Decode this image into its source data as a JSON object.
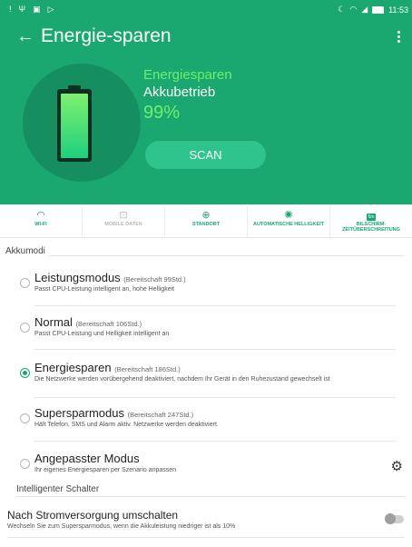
{
  "status_bar": {
    "left_icons": [
      "warning-icon",
      "usb-icon",
      "gallery-icon",
      "play-icon"
    ],
    "right_icons": [
      "moon-icon",
      "wifi-icon",
      "signal-icon",
      "battery-icon"
    ],
    "time": "11:53"
  },
  "app_bar": {
    "back_icon": "arrow-left-icon",
    "title": "Energie-sparen",
    "menu_icon": "kebab-icon"
  },
  "battery_panel": {
    "mode_green": "Energiesparen",
    "mode_white": "Akkubetrieb",
    "percent_text": "99%",
    "percent_value": 99,
    "scan_label": "SCAN"
  },
  "quick_toggles": [
    {
      "icon": "wifi-icon",
      "label": "WI-FI",
      "state": "on"
    },
    {
      "icon": "mobile-data-icon",
      "label": "MOBILE DATEN",
      "state": "off"
    },
    {
      "icon": "location-icon",
      "label": "STANDORT",
      "state": "on"
    },
    {
      "icon": "brightness-icon",
      "label": "AUTOMATISCHE HELLIGKEIT",
      "state": "on"
    },
    {
      "icon": "screen-timeout-icon",
      "label": "BILSCHIRM-ZEITÜBERSCHREITUNG",
      "state": "on",
      "badge": "5m"
    }
  ],
  "akkumodi": {
    "title": "Akkumodi",
    "options": [
      {
        "name": "Leistungsmodus",
        "hint": "(Bereitschaft 99Std.)",
        "desc": "Passt CPU-Leistung intelligent an, hohe Helligkeit",
        "selected": false
      },
      {
        "name": "Normal",
        "hint": "(Bereitschaft 106Std.)",
        "desc": "Passt CPU-Leistung und Helligkeit intelligent an",
        "selected": false
      },
      {
        "name": "Energiesparen",
        "hint": "(Bereitschaft 186Std.)",
        "desc": "Die Netzwerke werden vorübergehend deaktiviert, nachdem Ihr Gerät in den Ruhezustand gewechselt ist",
        "selected": true
      },
      {
        "name": "Supersparmodus",
        "hint": "(Bereitschaft 247Std.)",
        "desc": "Hält Telefon, SMS und Alarm aktiv. Netzwerke werden deaktiviert.",
        "selected": false
      },
      {
        "name": "Angepasster Modus",
        "hint": "",
        "desc": "Ihr eigenes Energiesparen per Szenario anpassen",
        "selected": false,
        "action_icon": "gear-icon"
      }
    ]
  },
  "intelligent": {
    "title": "Intelligenter Schalter",
    "item": {
      "title": "Nach Stromversorgung umschalten",
      "desc": "Wechseln Sie zum Supersparmodus, wenn die Akkuleistung niedriger ist als 10%",
      "enabled": false
    }
  },
  "colors": {
    "accent": "#1aa870",
    "header_bg": "#1aa870",
    "circle_bg": "#168f60",
    "highlight_text": "#6ef06a"
  }
}
